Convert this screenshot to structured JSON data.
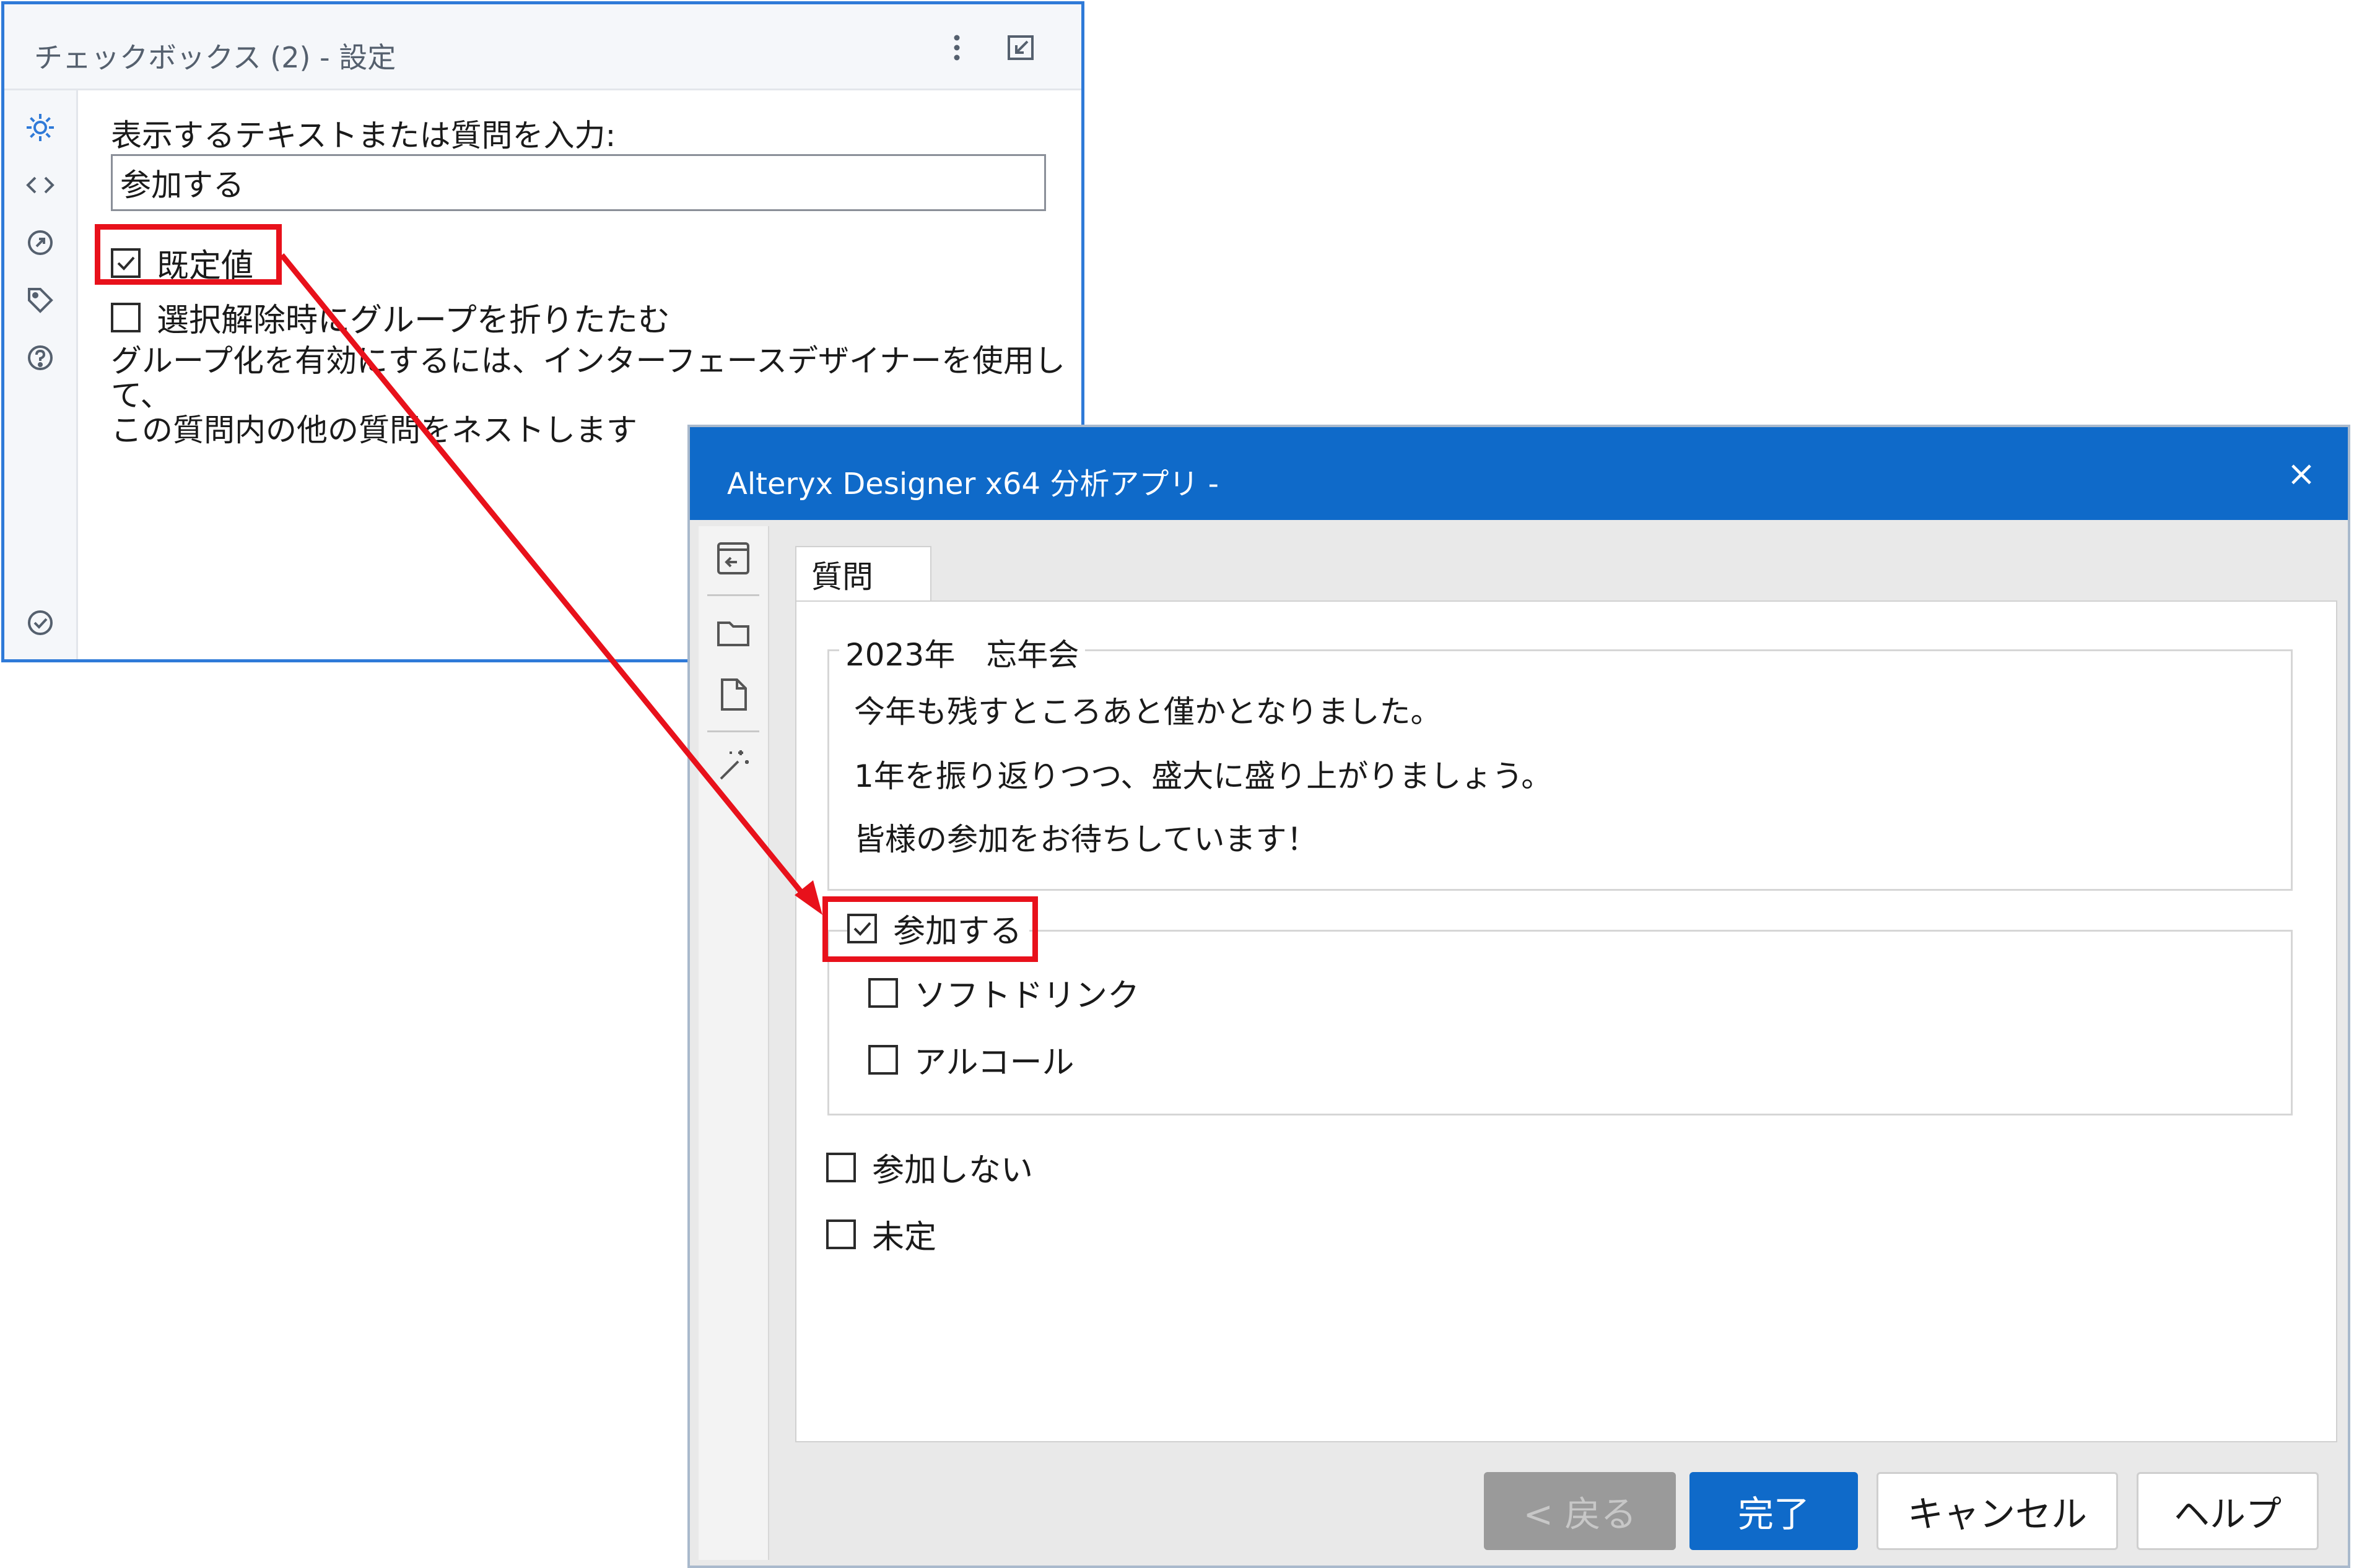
{
  "settings_panel": {
    "title": "チェックボックス (2) - 設定",
    "field_label": "表示するテキストまたは質問を入力:",
    "field_value": "参加する",
    "default_checkbox": {
      "label": "既定値",
      "checked": true
    },
    "collapse_checkbox": {
      "label": "選択解除時にグループを折りたたむ",
      "checked": false
    },
    "help_text_line1": "グループ化を有効にするには、インターフェースデザイナーを使用して、",
    "help_text_line2": "この質問内の他の質問をネストします",
    "icons": [
      "more-vertical-icon",
      "dock-icon",
      "gear-icon",
      "code-icon",
      "question-link-icon",
      "tag-icon",
      "help-icon",
      "check-circle-icon"
    ]
  },
  "dialog": {
    "title": "Alteryx Designer x64 分析アプリ -",
    "close_label": "×",
    "tab_label": "質問",
    "group_title": "2023年　忘年会",
    "group_lines": [
      "今年も残すところあと僅かとなりました。",
      "1年を振り返りつつ、盛大に盛り上がりましょう。",
      "皆様の参加をお待ちしています！"
    ],
    "main_checkbox": {
      "label": "参加する",
      "checked": true
    },
    "nested_options": [
      {
        "label": "ソフトドリンク",
        "checked": false
      },
      {
        "label": "アルコール",
        "checked": false
      }
    ],
    "other_options": [
      {
        "label": "参加しない",
        "checked": false
      },
      {
        "label": "未定",
        "checked": false
      }
    ],
    "buttons": {
      "back": "< 戻る",
      "finish": "完了",
      "cancel": "キャンセル",
      "help": "ヘルプ"
    },
    "rail_icons": [
      "back-to-list-icon",
      "folder-icon",
      "file-icon",
      "magic-wand-icon"
    ]
  },
  "colors": {
    "accent_blue": "#0f6ac9",
    "highlight_red": "#e8111b",
    "panel_border_blue": "#2f7ad8"
  }
}
